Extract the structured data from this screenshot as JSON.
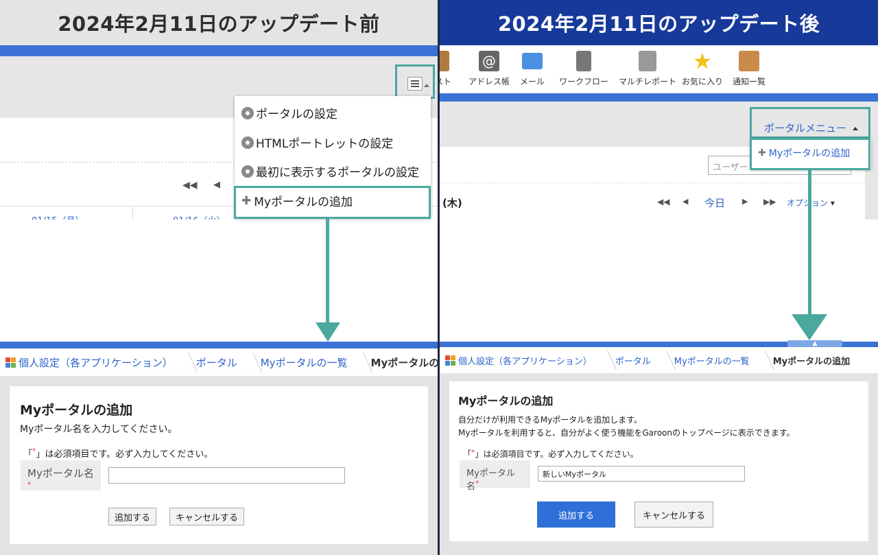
{
  "left": {
    "title": "2024年2月11日のアップデート前",
    "menu": {
      "items": [
        "ポータルの設定",
        "HTMLポートレットの設定",
        "最初に表示するポータルの設定",
        "Myポータルの追加"
      ]
    },
    "calendar": {
      "date1": "01/15（月）",
      "date2": "01/16（火）"
    },
    "breadcrumb": [
      "個人設定（各アプリケーション）",
      "ポータル",
      "Myポータルの一覧",
      "Myポータルの追加"
    ],
    "form": {
      "heading": "Myポータルの追加",
      "description": "Myポータル名を入力してください。",
      "required_note_prefix": "「",
      "required_mark": "*",
      "required_note_suffix": "」は必須項目です。必ず入力してください。",
      "field_label": "Myポータル名",
      "field_value": "",
      "add_button": "追加する",
      "cancel_button": "キャンセルする"
    }
  },
  "right": {
    "title": "2024年2月11日のアップデート後",
    "toolbar": [
      "リスト",
      "アドレス帳",
      "メール",
      "ワークフロー",
      "マルチレポート",
      "お気に入り",
      "通知一覧"
    ],
    "portal_menu": "ポータルメニュー",
    "dropdown_item": "Myポータルの追加",
    "user_search_placeholder": "ユーザー",
    "calendar": {
      "day": "(木)",
      "today": "今日",
      "options": "オプション"
    },
    "breadcrumb": [
      "個人設定（各アプリケーション）",
      "ポータル",
      "Myポータルの一覧",
      "Myポータルの追加"
    ],
    "form": {
      "heading": "Myポータルの追加",
      "description1": "自分だけが利用できるMyポータルを追加します。",
      "description2": "Myポータルを利用すると、自分がよく使う機能をGaroonのトップページに表示できます。",
      "required_note_prefix": "「",
      "required_mark": "*",
      "required_note_suffix": "」は必須項目です。必ず入力してください。",
      "field_label": "Myポータル名",
      "field_value": "新しいMyポータル",
      "add_button": "追加する",
      "cancel_button": "キャンセルする"
    }
  },
  "colors": {
    "highlight": "#4aa89f",
    "brand_blue": "#3b72d6",
    "header_navy": "#17399a",
    "link": "#2c63c8"
  }
}
